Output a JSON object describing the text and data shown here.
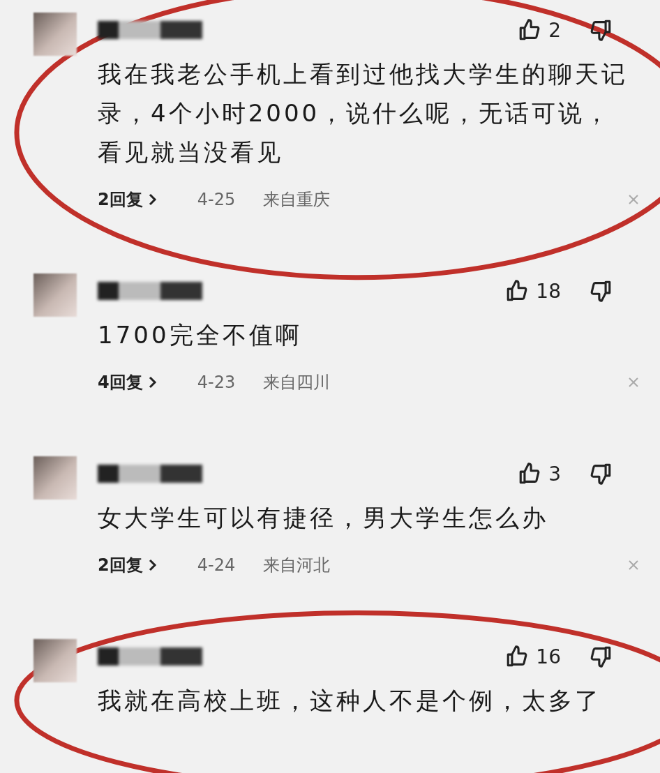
{
  "comments": [
    {
      "likes": "2",
      "body": "我在我老公手机上看到过他找大学生的聊天记录，4个小时2000，说什么呢，无话可说，看见就当没看见",
      "replies": "2回复",
      "date": "4-25",
      "location": "来自重庆",
      "circled": true
    },
    {
      "likes": "18",
      "body": "1700完全不值啊",
      "replies": "4回复",
      "date": "4-23",
      "location": "来自四川",
      "circled": false
    },
    {
      "likes": "3",
      "body": "女大学生可以有捷径，男大学生怎么办",
      "replies": "2回复",
      "date": "4-24",
      "location": "来自河北",
      "circled": false
    },
    {
      "likes": "16",
      "body": "我就在高校上班，这种人不是个例，太多了",
      "circled": true
    }
  ]
}
